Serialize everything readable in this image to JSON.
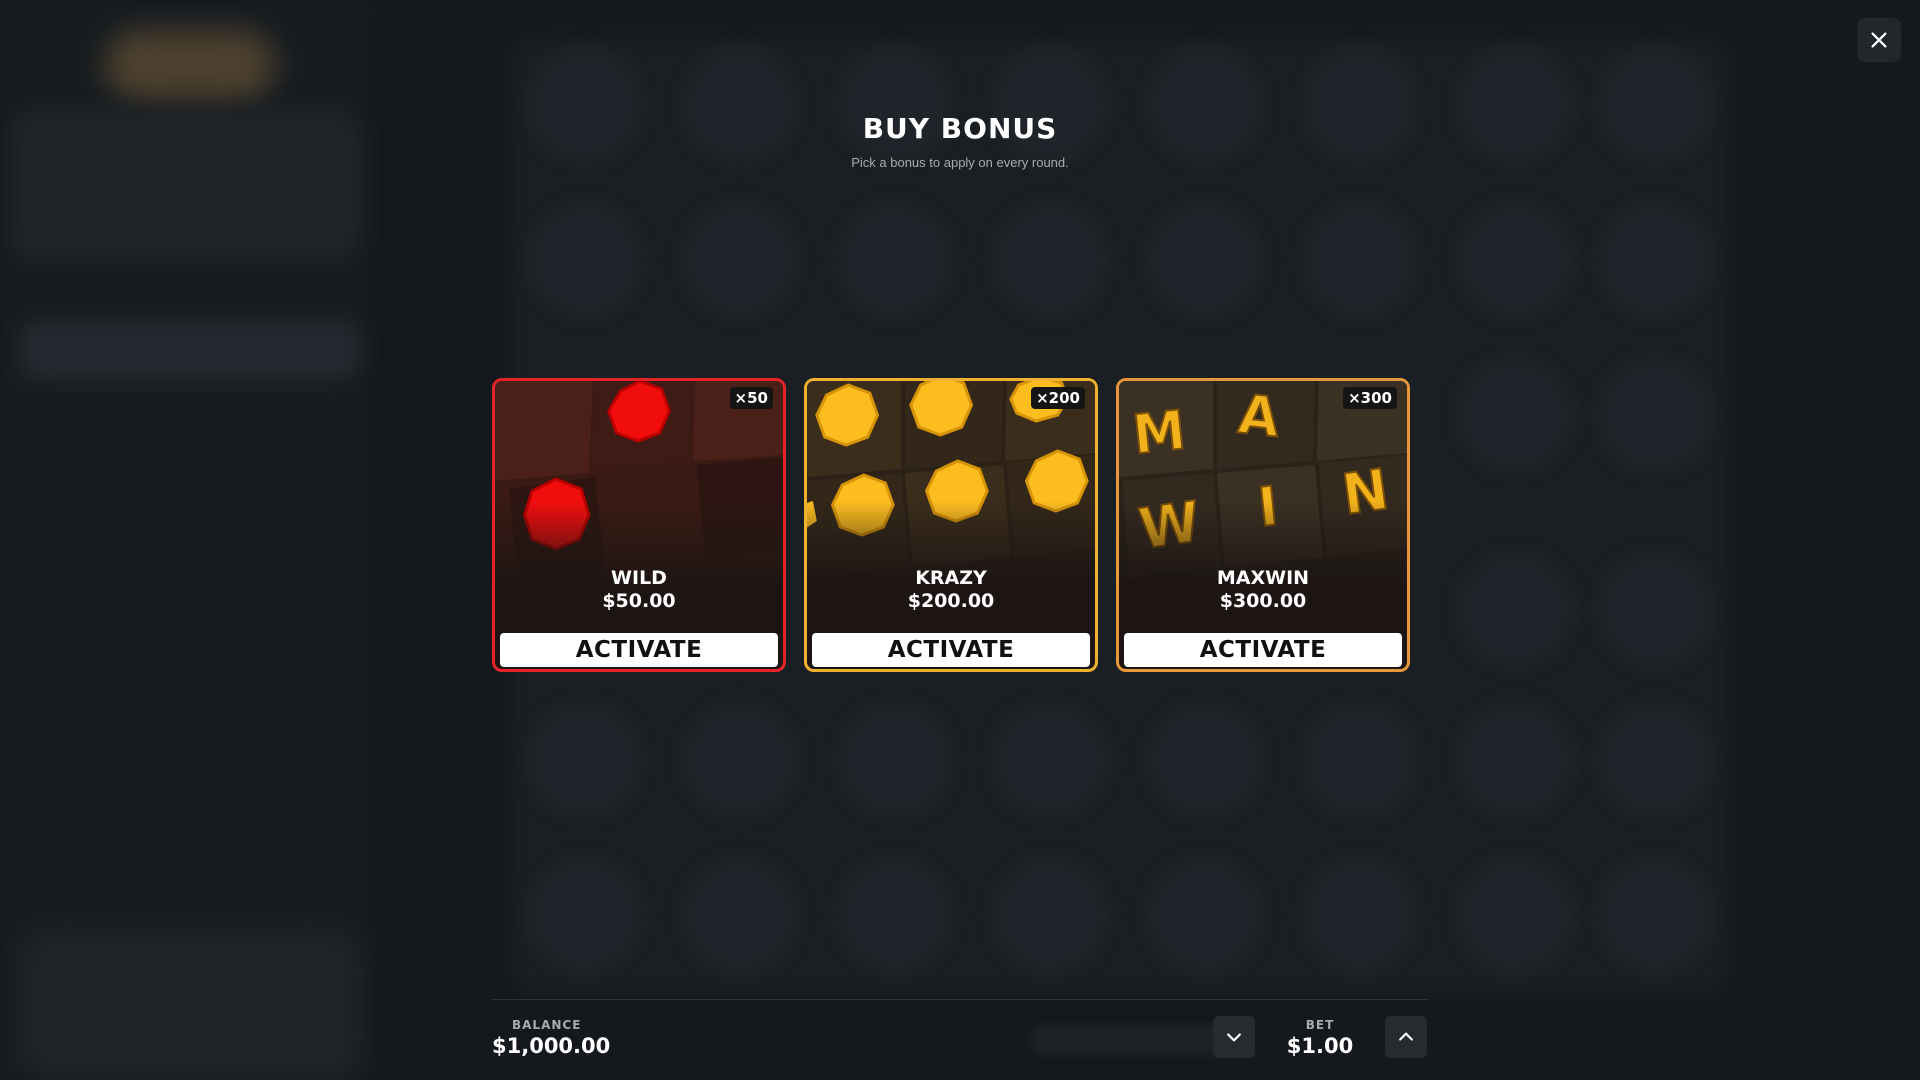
{
  "modal": {
    "title": "BUY BONUS",
    "subtitle": "Pick a bonus to apply on every round."
  },
  "cards": [
    {
      "name": "WILD",
      "price": "$50.00",
      "multiplier": "×50",
      "button": "ACTIVATE",
      "accent": "#e5242a"
    },
    {
      "name": "KRAZY",
      "price": "$200.00",
      "multiplier": "×200",
      "button": "ACTIVATE",
      "accent": "#f0b12f"
    },
    {
      "name": "MAXWIN",
      "price": "$300.00",
      "multiplier": "×300",
      "button": "ACTIVATE",
      "accent": "#e8963a",
      "art_letters": [
        "M",
        "A",
        "W",
        "I",
        "N"
      ]
    }
  ],
  "footer": {
    "balance_label": "BALANCE",
    "balance_value": "$1,000.00",
    "bet_label": "BET",
    "bet_value": "$1.00"
  },
  "icons": {
    "close": "close-icon",
    "decrease": "chevron-down-icon",
    "increase": "chevron-up-icon"
  }
}
